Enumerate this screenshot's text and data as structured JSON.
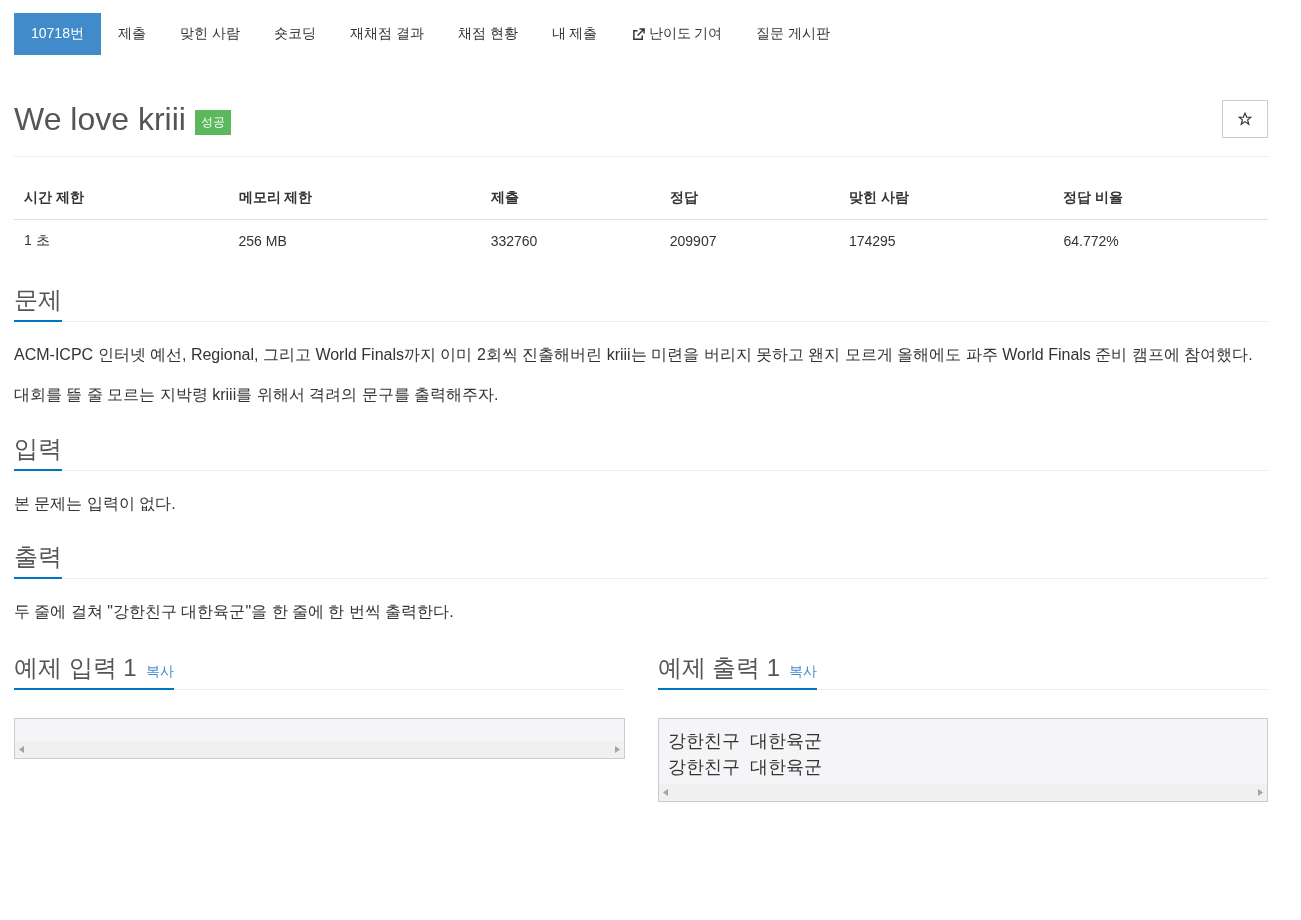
{
  "tabs": [
    {
      "label": "10718번",
      "selected": true,
      "kind": "plain"
    },
    {
      "label": "제출",
      "selected": false,
      "kind": "plain"
    },
    {
      "label": "맞힌 사람",
      "selected": false,
      "kind": "plain"
    },
    {
      "label": "숏코딩",
      "selected": false,
      "kind": "plain"
    },
    {
      "label": "재채점 결과",
      "selected": false,
      "kind": "plain"
    },
    {
      "label": "채점 현황",
      "selected": false,
      "kind": "plain"
    },
    {
      "label": "내 제출",
      "selected": false,
      "kind": "plain"
    },
    {
      "label": "난이도 기여",
      "selected": false,
      "kind": "external"
    },
    {
      "label": "질문 게시판",
      "selected": false,
      "kind": "plain"
    }
  ],
  "problem": {
    "title": "We love kriii",
    "badge": "성공"
  },
  "info_table": {
    "columns": [
      "시간 제한",
      "메모리 제한",
      "제출",
      "정답",
      "맞힌 사람",
      "정답 비율"
    ],
    "rows": [
      [
        "1 초",
        "256 MB",
        "332760",
        "209907",
        "174295",
        "64.772%"
      ]
    ]
  },
  "sections": [
    {
      "heading": "문제",
      "paragraphs": [
        "ACM-ICPC 인터넷 예선, Regional, 그리고 World Finals까지 이미 2회씩 진출해버린 kriii는 미련을 버리지 못하고 왠지 모르게 올해에도 파주 World Finals 준비 캠프에 참여했다.",
        "대회를 뜰 줄 모르는 지박령 kriii를 위해서 격려의 문구를 출력해주자."
      ]
    },
    {
      "heading": "입력",
      "paragraphs": [
        "본 문제는 입력이 없다."
      ]
    },
    {
      "heading": "출력",
      "paragraphs": [
        "두 줄에 걸쳐 \"강한친구 대한육군\"을 한 줄에 한 번씩 출력한다."
      ]
    }
  ],
  "samples": [
    {
      "heading": "예제 입력 1",
      "copy": "복사"
    },
    {
      "heading": "예제 출력 1",
      "copy": "복사",
      "lines": [
        "강한친구 대한육군",
        "강한친구 대한육군"
      ]
    }
  ]
}
